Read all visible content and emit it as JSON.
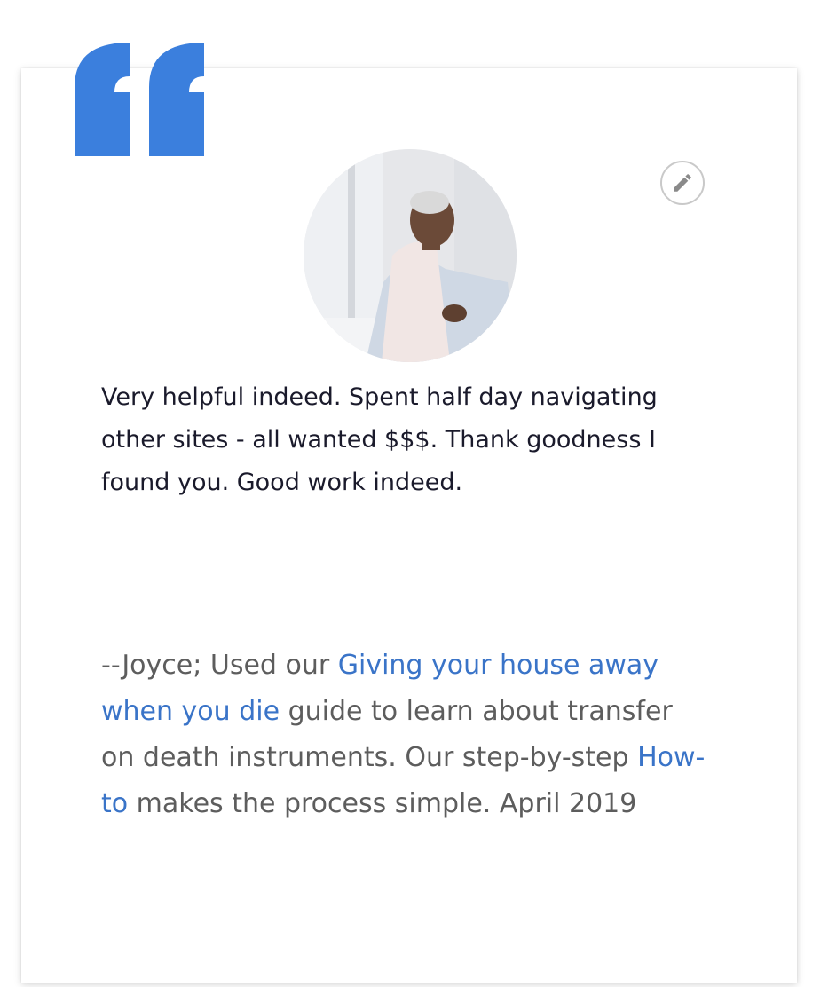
{
  "colors": {
    "quote_mark": "#3b7fdd",
    "link": "#3a74c8",
    "review_text": "#1a1a2b",
    "attribution_text": "#5d5d5d"
  },
  "icons": {
    "quote": "quote-icon",
    "edit": "pencil-icon"
  },
  "testimonial": {
    "review_text": "Very helpful indeed. Spent half day navigating other sites - all wanted $$$. Thank goodness I found you. Good work indeed.",
    "attribution_prefix": "--Joyce; Used our ",
    "guide_link": "Giving your house away when you die",
    "attribution_middle": " guide to learn about transfer on death instruments. Our step-by-step ",
    "howto_link": "How-to",
    "attribution_suffix": " makes the process simple. April 2019"
  }
}
